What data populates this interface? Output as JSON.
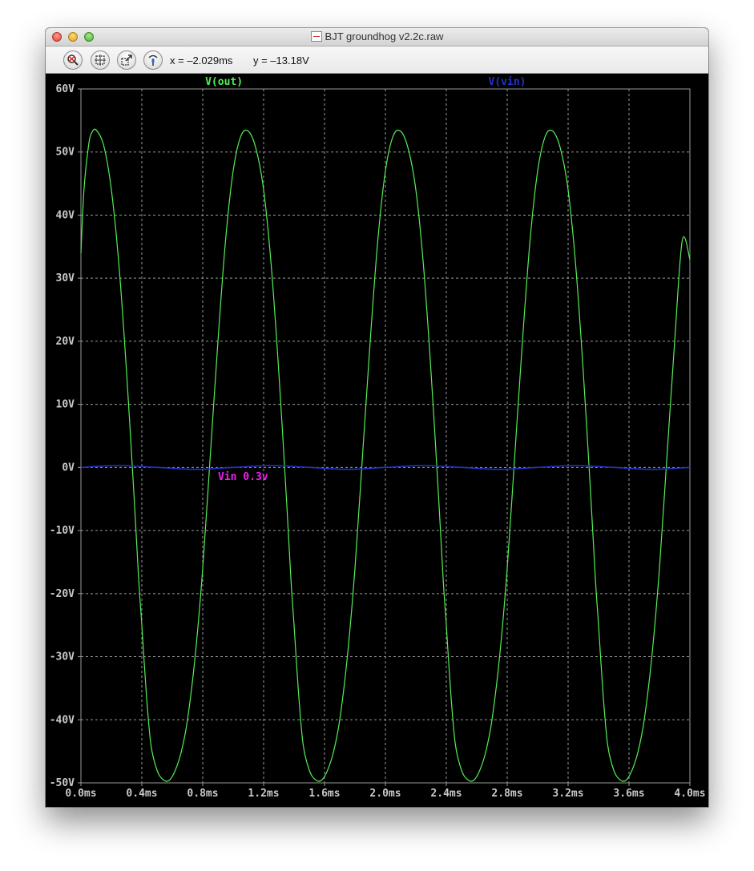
{
  "window": {
    "title": "BJT groundhog v2.2c.raw"
  },
  "toolbar": {
    "buttons": [
      {
        "name": "zoom-out-icon"
      },
      {
        "name": "zoom-fit-icon"
      },
      {
        "name": "zoom-area-icon"
      },
      {
        "name": "probe-icon"
      }
    ],
    "cursor_x": "x = –2.029ms",
    "cursor_y": "y = –13.18V"
  },
  "colors": {
    "plot_background": "#000000",
    "grid": "#9a9a9a",
    "axis_text": "#c8c8c8",
    "vout": "#55ee55",
    "vin": "#2233cc",
    "annotation": "#ee22ee"
  },
  "chart_data": {
    "type": "line",
    "x_unit": "ms",
    "y_unit": "V",
    "xlim": [
      0.0,
      4.0
    ],
    "ylim": [
      -50,
      60
    ],
    "grid": true,
    "x_ticks": [
      "0.0ms",
      "0.4ms",
      "0.8ms",
      "1.2ms",
      "1.6ms",
      "2.0ms",
      "2.4ms",
      "2.8ms",
      "3.2ms",
      "3.6ms",
      "4.0ms"
    ],
    "y_ticks": [
      "60V",
      "50V",
      "40V",
      "30V",
      "20V",
      "10V",
      "0V",
      "-10V",
      "-20V",
      "-30V",
      "-40V",
      "-50V"
    ],
    "series": [
      {
        "name": "V(out)",
        "color": "#55ee55",
        "x": [
          0.0,
          0.02,
          0.05,
          0.07,
          0.1,
          0.15,
          0.2,
          0.25,
          0.3,
          0.35,
          0.38,
          0.4,
          0.43,
          0.46,
          0.5,
          0.54,
          0.58,
          0.62,
          0.66,
          0.7,
          0.75,
          0.8,
          0.85,
          0.9,
          0.95,
          1.0,
          1.05,
          1.1,
          1.15,
          1.2,
          1.25,
          1.3,
          1.35,
          1.38,
          1.4,
          1.43,
          1.46,
          1.5,
          1.54,
          1.58,
          1.62,
          1.66,
          1.7,
          1.75,
          1.8,
          1.85,
          1.9,
          1.95,
          2.0,
          2.05,
          2.1,
          2.15,
          2.2,
          2.25,
          2.3,
          2.35,
          2.38,
          2.4,
          2.43,
          2.46,
          2.5,
          2.54,
          2.58,
          2.62,
          2.66,
          2.7,
          2.75,
          2.8,
          2.85,
          2.9,
          2.95,
          3.0,
          3.05,
          3.1,
          3.15,
          3.2,
          3.25,
          3.3,
          3.35,
          3.38,
          3.4,
          3.43,
          3.46,
          3.5,
          3.54,
          3.58,
          3.62,
          3.66,
          3.7,
          3.75,
          3.8,
          3.85,
          3.9,
          3.95,
          4.0
        ],
        "y": [
          34,
          44,
          51,
          53,
          53.5,
          51,
          44,
          32,
          15,
          -5,
          -18,
          -25,
          -36,
          -44,
          -48,
          -49.5,
          -49.6,
          -48,
          -45,
          -40,
          -30,
          -16,
          2,
          20,
          36,
          47,
          52.5,
          53.3,
          50.5,
          44,
          32,
          15,
          -5,
          -18,
          -25,
          -36,
          -44,
          -48,
          -49.5,
          -49.6,
          -48,
          -45,
          -40,
          -30,
          -16,
          2,
          20,
          36,
          47,
          52.5,
          53.3,
          50.5,
          44,
          32,
          15,
          -5,
          -18,
          -25,
          -36,
          -44,
          -48,
          -49.5,
          -49.6,
          -48,
          -45,
          -40,
          -30,
          -16,
          2,
          20,
          36,
          47,
          52.5,
          53.3,
          50.5,
          44,
          32,
          15,
          -5,
          -18,
          -25,
          -36,
          -44,
          -48,
          -49.5,
          -49.6,
          -48,
          -45,
          -40,
          -30,
          -16,
          2,
          20,
          36,
          33
        ]
      },
      {
        "name": "V(vin)",
        "color": "#2233cc",
        "x": [
          0.0,
          0.25,
          0.5,
          0.75,
          1.0,
          1.25,
          1.5,
          1.75,
          2.0,
          2.25,
          2.5,
          2.75,
          3.0,
          3.25,
          3.5,
          3.75,
          4.0
        ],
        "y": [
          0.0,
          0.3,
          0.0,
          -0.3,
          0.0,
          0.3,
          0.0,
          -0.3,
          0.0,
          0.3,
          0.0,
          -0.3,
          0.0,
          0.3,
          0.0,
          -0.3,
          0.0
        ]
      }
    ],
    "annotations": [
      {
        "text": "Vin 0.3v",
        "x": 0.9,
        "y": -2.0,
        "color": "#ee22ee"
      }
    ]
  }
}
